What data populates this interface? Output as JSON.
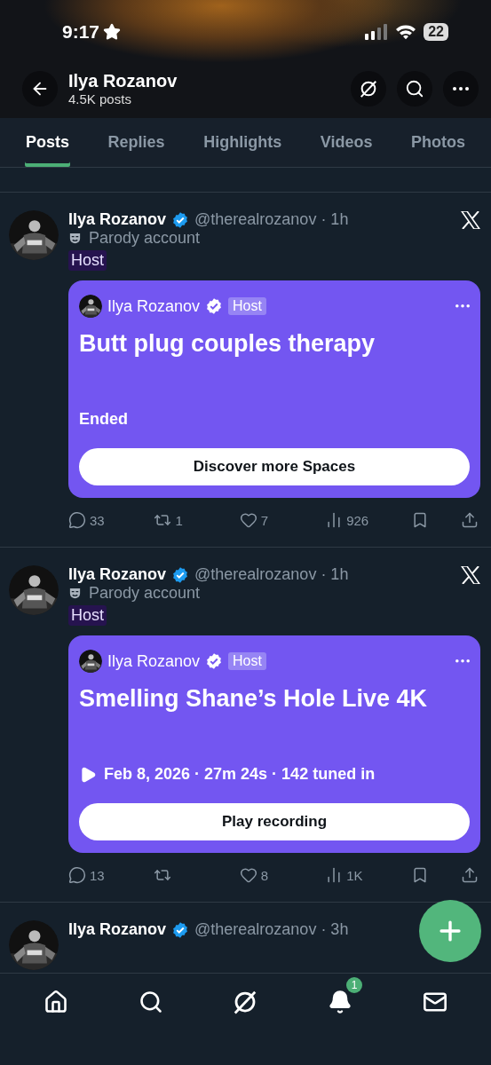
{
  "status_bar": {
    "time": "9:17",
    "battery": "22"
  },
  "header": {
    "title": "Ilya Rozanov",
    "subtitle": "4.5K posts"
  },
  "tabs": [
    {
      "label": "Posts",
      "selected": true
    },
    {
      "label": "Replies",
      "selected": false
    },
    {
      "label": "Highlights",
      "selected": false
    },
    {
      "label": "Videos",
      "selected": false
    },
    {
      "label": "Photos",
      "selected": false
    }
  ],
  "posts": [
    {
      "name": "Ilya Rozanov",
      "meta": "@therealrozanov · 1h",
      "label": "Parody account",
      "badge": "Host",
      "space": {
        "host": "Ilya Rozanov",
        "role": "Host",
        "title": "Butt plug couples therapy",
        "kind": "ended",
        "status": "Ended",
        "button": "Discover more Spaces"
      },
      "stats": [
        {
          "kind": "reply",
          "count": "33"
        },
        {
          "kind": "repost",
          "count": "1"
        },
        {
          "kind": "like",
          "count": "7"
        },
        {
          "kind": "views",
          "count": "926"
        },
        {
          "kind": "bookmark"
        },
        {
          "kind": "share"
        }
      ]
    },
    {
      "name": "Ilya Rozanov",
      "meta": "@therealrozanov · 1h",
      "label": "Parody account",
      "badge": "Host",
      "space": {
        "host": "Ilya Rozanov",
        "role": "Host",
        "title": "Smelling Shane’s Hole Live 4K",
        "kind": "recording",
        "status": "Feb 8, 2026 · 27m 24s · 142 tuned in",
        "button": "Play recording"
      },
      "stats": [
        {
          "kind": "reply",
          "count": "13"
        },
        {
          "kind": "repost"
        },
        {
          "kind": "like",
          "count": "8"
        },
        {
          "kind": "views",
          "count": "1K"
        },
        {
          "kind": "bookmark"
        },
        {
          "kind": "share"
        }
      ]
    },
    {
      "name": "Ilya Rozanov",
      "meta": "@therealrozanov · 3h"
    }
  ],
  "nav": [
    {
      "kind": "home"
    },
    {
      "kind": "search"
    },
    {
      "kind": "grok"
    },
    {
      "kind": "notifications",
      "badge": "1"
    },
    {
      "kind": "messages"
    }
  ]
}
